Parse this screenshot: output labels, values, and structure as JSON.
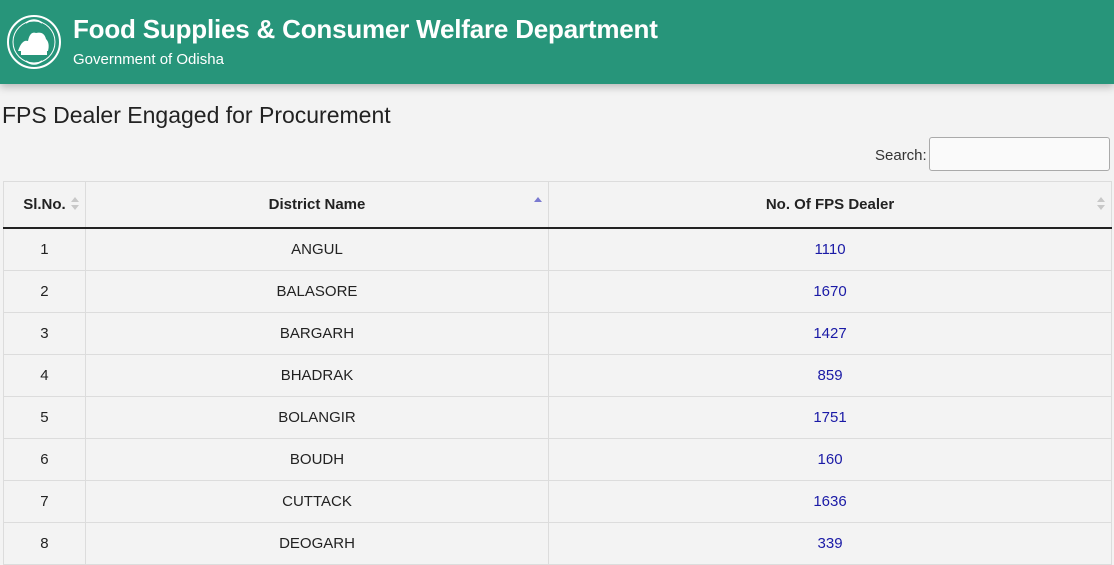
{
  "header": {
    "title": "Food Supplies & Consumer Welfare Department",
    "subtitle": "Government of Odisha",
    "logo_icon": "odisha-emblem-icon",
    "bg_color": "#27957a"
  },
  "page": {
    "title": "FPS Dealer Engaged for Procurement"
  },
  "search": {
    "label": "Search:",
    "value": ""
  },
  "table": {
    "columns": [
      "Sl.No.",
      "District Name",
      "No. Of FPS Dealer"
    ],
    "sorted_column": "District Name",
    "sort_direction": "ascending",
    "rows": [
      {
        "sl": "1",
        "district": "ANGUL",
        "count": "1110"
      },
      {
        "sl": "2",
        "district": "BALASORE",
        "count": "1670"
      },
      {
        "sl": "3",
        "district": "BARGARH",
        "count": "1427"
      },
      {
        "sl": "4",
        "district": "BHADRAK",
        "count": "859"
      },
      {
        "sl": "5",
        "district": "BOLANGIR",
        "count": "1751"
      },
      {
        "sl": "6",
        "district": "BOUDH",
        "count": "160"
      },
      {
        "sl": "7",
        "district": "CUTTACK",
        "count": "1636"
      },
      {
        "sl": "8",
        "district": "DEOGARH",
        "count": "339"
      }
    ]
  }
}
